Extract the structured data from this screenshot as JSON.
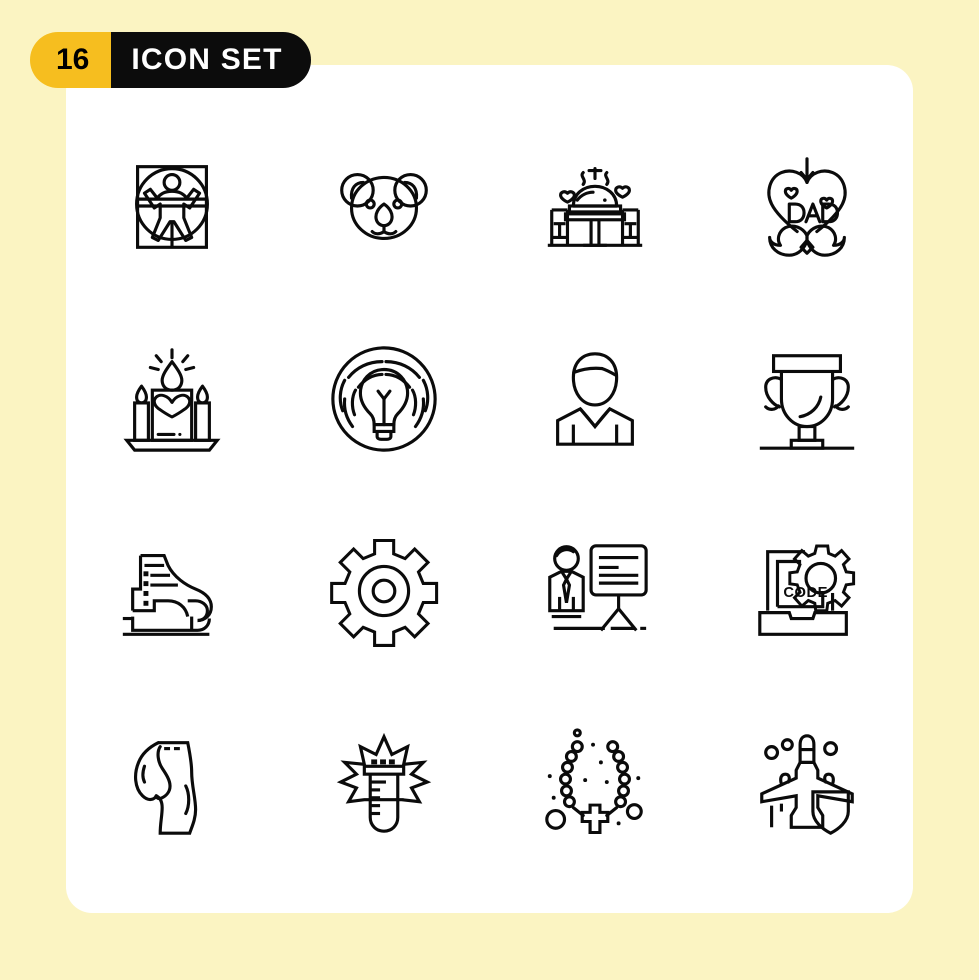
{
  "page": {
    "background_color": "#FBF4C2",
    "card_color": "#FFFFFF"
  },
  "header": {
    "count": "16",
    "title": "ICON SET",
    "count_bg": "#F6BE1F",
    "title_bg": "#0C0C0C",
    "title_color": "#FFFFFF"
  },
  "grid": {
    "columns": 4,
    "rows": 4,
    "stroke_color": "#0B0B0B"
  },
  "icons": [
    {
      "index": 1,
      "name": "vitruvian-man-icon",
      "label": "Vitruvian Man"
    },
    {
      "index": 2,
      "name": "koala-face-icon",
      "label": "Koala"
    },
    {
      "index": 3,
      "name": "romantic-dinner-icon",
      "label": "Romantic Dinner"
    },
    {
      "index": 4,
      "name": "dad-heart-mustache-icon",
      "label": "Dad Heart Mustache",
      "text": "DAD"
    },
    {
      "index": 5,
      "name": "heart-candles-icon",
      "label": "Candles"
    },
    {
      "index": 6,
      "name": "idea-lightbulb-icon",
      "label": "Idea Lightbulb"
    },
    {
      "index": 7,
      "name": "businessman-avatar-icon",
      "label": "Businessman"
    },
    {
      "index": 8,
      "name": "trophy-icon",
      "label": "Trophy"
    },
    {
      "index": 9,
      "name": "ice-skate-icon",
      "label": "Ice Skate"
    },
    {
      "index": 10,
      "name": "gear-settings-icon",
      "label": "Settings Gear"
    },
    {
      "index": 11,
      "name": "presentation-training-icon",
      "label": "Presentation"
    },
    {
      "index": 12,
      "name": "laptop-code-gear-icon",
      "label": "Code Development",
      "text": "CODE"
    },
    {
      "index": 13,
      "name": "pregnancy-belly-icon",
      "label": "Pregnancy"
    },
    {
      "index": 14,
      "name": "test-tube-burst-icon",
      "label": "Test Tube Experiment"
    },
    {
      "index": 15,
      "name": "rosary-cross-icon",
      "label": "Rosary"
    },
    {
      "index": 16,
      "name": "fighter-jet-shield-icon",
      "label": "Fighter Jet Shield"
    }
  ]
}
